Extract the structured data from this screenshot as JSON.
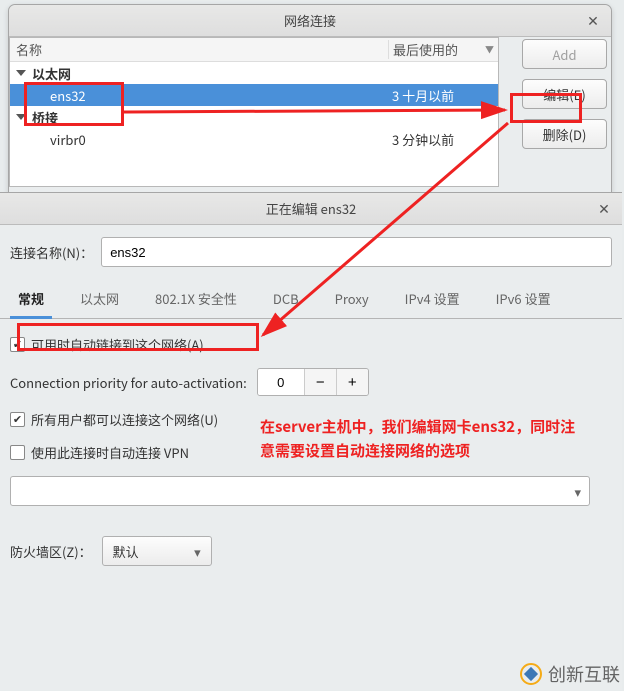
{
  "window1": {
    "title": "网络连接",
    "columns": {
      "name": "名称",
      "last": "最后使用的"
    },
    "categories": [
      {
        "label": "以太网",
        "items": [
          {
            "name": "ens32",
            "last": "3 十月以前",
            "selected": true
          }
        ]
      },
      {
        "label": "桥接",
        "items": [
          {
            "name": "virbr0",
            "last": "3 分钟以前",
            "selected": false
          }
        ]
      }
    ],
    "buttons": {
      "add": "Add",
      "edit": "编辑(E)",
      "delete": "删除(D)"
    }
  },
  "window2": {
    "title": "正在编辑  ens32",
    "name_label": "连接名称(N)：",
    "name_value": "ens32",
    "tabs": [
      "常规",
      "以太网",
      "802.1X 安全性",
      "DCB",
      "Proxy",
      "IPv4 设置",
      "IPv6 设置"
    ],
    "active_tab": 0,
    "general": {
      "auto_connect": {
        "label": "可用时自动链接到这个网络(A)",
        "checked": true
      },
      "priority_label": "Connection priority for auto-activation:",
      "priority_value": "0",
      "all_users": {
        "label": "所有用户都可以连接这个网络(U)",
        "checked": true
      },
      "vpn_auto": {
        "label": "使用此连接时自动连接 VPN",
        "checked": false
      },
      "vpn_select": "",
      "zone_label": "防火墙区(Z)：",
      "zone_value": "默认"
    }
  },
  "annotation": {
    "line1": "在server主机中，我们编辑网卡ens32，同时注",
    "line2": "意需要设置自动连接网络的选项"
  },
  "watermark": "创新互联"
}
